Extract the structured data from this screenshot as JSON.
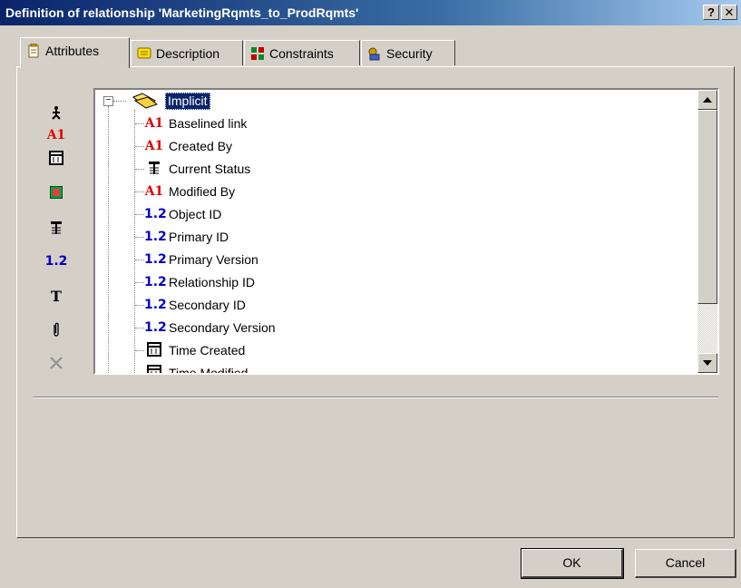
{
  "window": {
    "title": "Definition of relationship 'MarketingRqmts_to_ProdRqmts'",
    "help_label": "?",
    "close_label": "✕"
  },
  "tabs": [
    {
      "label": "Attributes",
      "icon": "tag-icon",
      "active": true
    },
    {
      "label": "Description",
      "icon": "note-icon",
      "active": false
    },
    {
      "label": "Constraints",
      "icon": "constraints-icon",
      "active": false
    },
    {
      "label": "Security",
      "icon": "security-icon",
      "active": false
    }
  ],
  "toolbar": {
    "a1_label": "A1",
    "num_label": "1.2",
    "text_label": "T"
  },
  "tree": {
    "expander": "−",
    "root": "Implicit",
    "items": [
      {
        "type": "text",
        "icon_text": "A1",
        "label": "Baselined link"
      },
      {
        "type": "text",
        "icon_text": "A1",
        "label": "Created By"
      },
      {
        "type": "list",
        "icon_text": "",
        "label": "Current Status"
      },
      {
        "type": "text",
        "icon_text": "A1",
        "label": "Modified By"
      },
      {
        "type": "number",
        "icon_text": "1.2",
        "label": "Object ID"
      },
      {
        "type": "number",
        "icon_text": "1.2",
        "label": "Primary ID"
      },
      {
        "type": "number",
        "icon_text": "1.2",
        "label": "Primary Version"
      },
      {
        "type": "number",
        "icon_text": "1.2",
        "label": "Relationship ID"
      },
      {
        "type": "number",
        "icon_text": "1.2",
        "label": "Secondary ID"
      },
      {
        "type": "number",
        "icon_text": "1.2",
        "label": "Secondary Version"
      },
      {
        "type": "date",
        "icon_text": "15",
        "label": "Time Created"
      },
      {
        "type": "date",
        "icon_text": "15",
        "label": "Time Modified"
      }
    ]
  },
  "buttons": {
    "ok": "OK",
    "cancel": "Cancel"
  },
  "colors": {
    "titlebar": "#0a246a",
    "text_attr": "#e00000",
    "number_attr": "#0000c8",
    "face": "#d4d0c8"
  }
}
